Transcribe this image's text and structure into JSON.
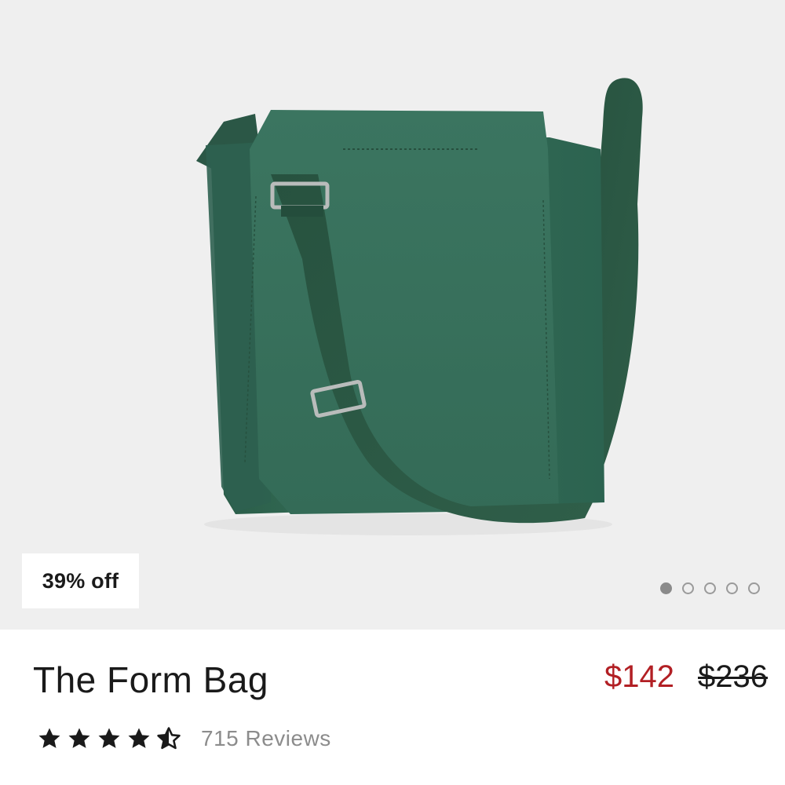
{
  "product": {
    "discount_badge": "39% off",
    "name": "The Form Bag",
    "sale_price": "$142",
    "original_price": "$236",
    "rating_value": 4.5,
    "rating_max": 5,
    "reviews_label": "715 Reviews",
    "image_subject": "green leather crossbody bag with woven strap",
    "colors": {
      "sale_price": "#b21f24",
      "bag": "#2f6650",
      "background": "#efefef"
    }
  },
  "carousel": {
    "total_images": 5,
    "active_index": 0
  },
  "icons": {
    "star": "star-icon",
    "half_star": "half-star-icon"
  }
}
